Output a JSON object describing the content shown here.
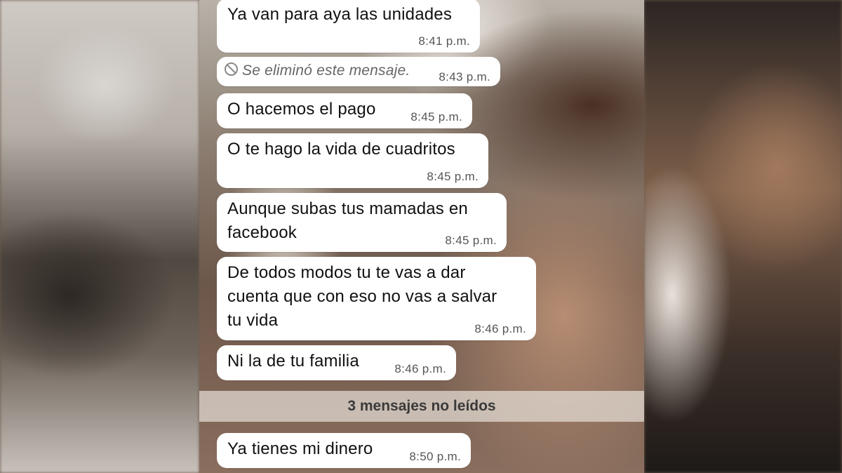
{
  "messages": [
    {
      "text": "Ya van para aya las unidades",
      "time": "8:41 p.m."
    },
    {
      "text": "Se eliminó este mensaje.",
      "time": "8:43 p.m.",
      "deleted": true
    },
    {
      "text": "O hacemos el pago",
      "time": "8:45 p.m."
    },
    {
      "text": "O te hago la vida de cuadritos",
      "time": "8:45 p.m."
    },
    {
      "text_lines": [
        "Aunque subas tus mamadas en",
        "facebook"
      ],
      "time": "8:45 p.m."
    },
    {
      "text_lines": [
        "De todos modos tu te vas a dar",
        "cuenta que con eso no vas a salvar",
        "tu vida"
      ],
      "time": "8:46 p.m."
    },
    {
      "text": "Ni la de tu familia",
      "time": "8:46 p.m."
    },
    {
      "text": "Ya tienes mi dinero",
      "time": "8:50 p.m."
    }
  ],
  "unread_banner": "3 mensajes no leídos",
  "colors": {
    "bubble": "#ffffff",
    "timestamp": "#555555",
    "banner_text": "#3a3a3a"
  },
  "icons": {
    "deleted": "ban-icon"
  }
}
